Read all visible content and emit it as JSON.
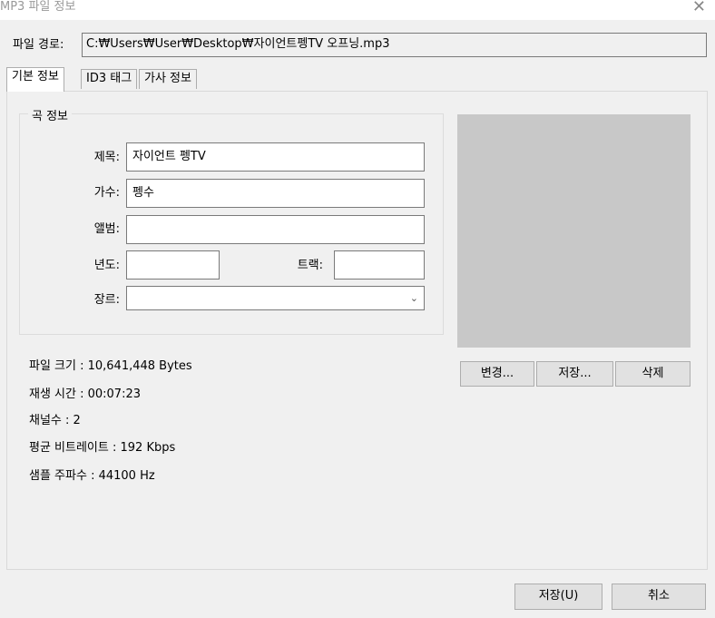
{
  "window": {
    "title": "MP3 파일 정보",
    "close_glyph": "✕"
  },
  "path": {
    "label": "파일 경로:",
    "value": "C:₩Users₩User₩Desktop₩자이언트펭TV 오프닝.mp3"
  },
  "tabs": [
    {
      "label": "기본 정보",
      "active": true
    },
    {
      "label": "ID3 태그",
      "active": false
    },
    {
      "label": "가사 정보",
      "active": false
    }
  ],
  "song_info": {
    "title": "곡 정보",
    "fields": {
      "title_label": "제목:",
      "title_value": "자이언트 펭TV",
      "artist_label": "가수:",
      "artist_value": "펭수",
      "album_label": "앨범:",
      "album_value": "",
      "year_label": "년도:",
      "year_value": "",
      "track_label": "트랙:",
      "track_value": "",
      "genre_label": "장르:",
      "genre_value": ""
    }
  },
  "art_buttons": {
    "change": "변경...",
    "save": "저장...",
    "delete": "삭제"
  },
  "file_info": [
    "파일 크기 : 10,641,448 Bytes",
    "재생 시간 : 00:07:23",
    "채널수 : 2",
    "평균 비트레이트 : 192 Kbps",
    "샘플 주파수 : 44100 Hz"
  ],
  "footer": {
    "save": "저장(U)",
    "cancel": "취소"
  },
  "icons": {
    "close": "close-icon",
    "dropdown": "chevron-down-icon"
  }
}
